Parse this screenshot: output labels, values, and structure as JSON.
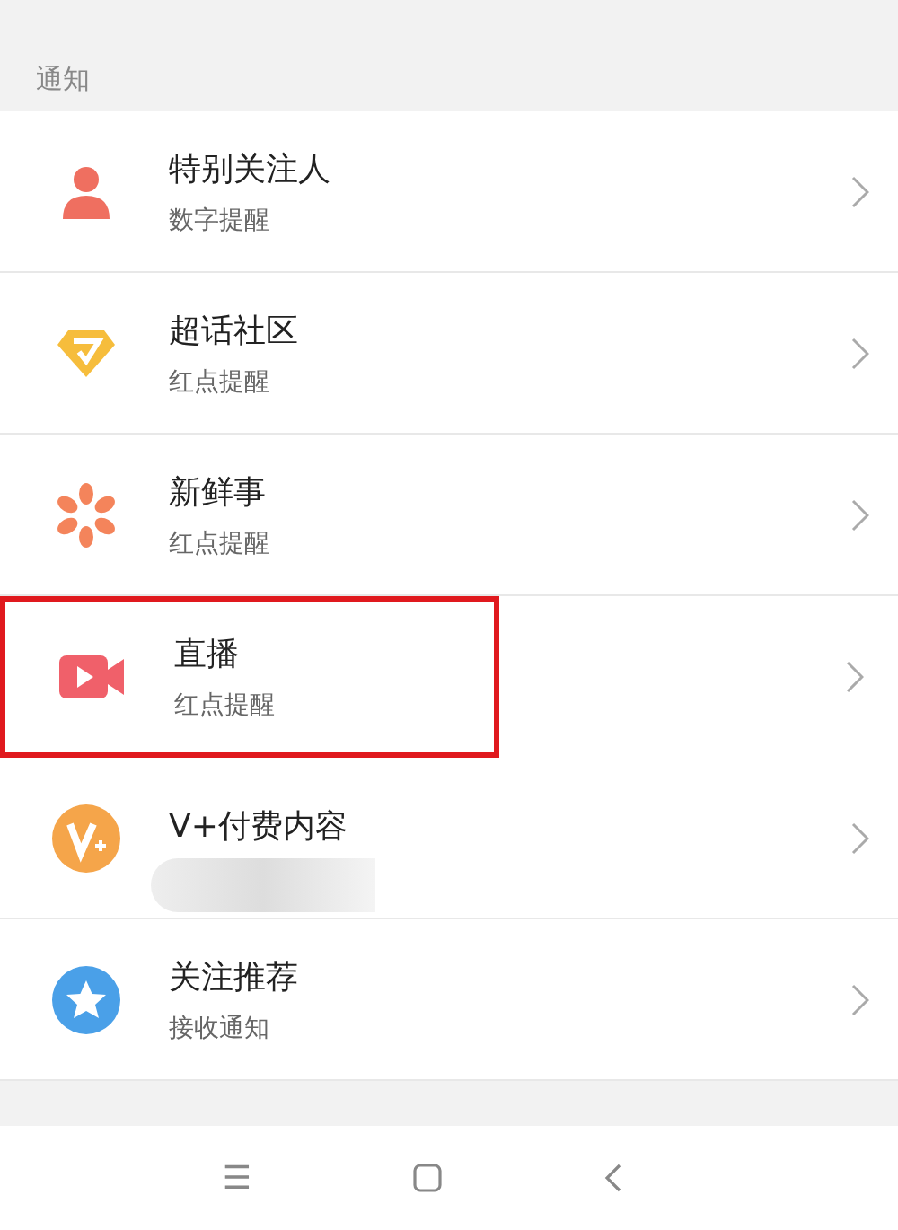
{
  "section_title": "通知",
  "items": [
    {
      "kind": "person",
      "title": "特别关注人",
      "subtitle": "数字提醒",
      "highlighted": false
    },
    {
      "kind": "diamond",
      "title": "超话社区",
      "subtitle": "红点提醒",
      "highlighted": false
    },
    {
      "kind": "flower",
      "title": "新鲜事",
      "subtitle": "红点提醒",
      "highlighted": false
    },
    {
      "kind": "video",
      "title": "直播",
      "subtitle": "红点提醒",
      "highlighted": true
    },
    {
      "kind": "vplus",
      "title": "V+付费内容",
      "blurred": true,
      "highlighted": false
    },
    {
      "kind": "star",
      "title": "关注推荐",
      "subtitle": "接收通知",
      "highlighted": false
    }
  ],
  "nav_bar": {
    "menu": "☰"
  }
}
